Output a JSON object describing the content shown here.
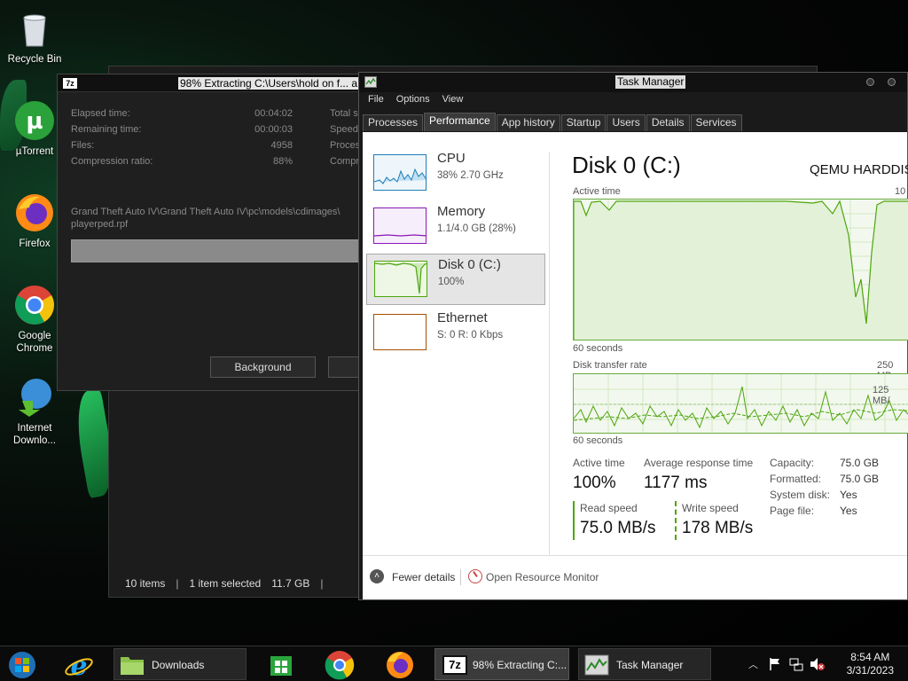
{
  "desktop": {
    "icons": [
      {
        "label": "Recycle Bin",
        "icon": "recycle-bin-icon"
      },
      {
        "label": "µTorrent",
        "icon": "utorrent-icon"
      },
      {
        "label": "Firefox",
        "icon": "firefox-icon"
      },
      {
        "label": "Google Chrome",
        "icon": "chrome-icon"
      },
      {
        "label": "Internet Downlo...",
        "icon": "idm-icon"
      }
    ]
  },
  "explorer": {
    "status_items": "10 items",
    "status_selected": "1 item selected",
    "status_size": "11.7 GB",
    "sep": "|"
  },
  "sevenzip": {
    "title": "98% Extracting C:\\Users\\hold on f... a",
    "icon_text": "7z",
    "rows": [
      {
        "label": "Elapsed time:",
        "value": "00:04:02",
        "right": "Total s"
      },
      {
        "label": "Remaining time:",
        "value": "00:00:03",
        "right": "Speed:"
      },
      {
        "label": "Files:",
        "value": "4958",
        "right": "Proces"
      },
      {
        "label": "Compression ratio:",
        "value": "88%",
        "right": "Compre"
      }
    ],
    "path_line1": "Grand Theft Auto IV\\Grand Theft Auto IV\\pc\\models\\cdimages\\",
    "path_line2": "playerped.rpf",
    "progress": 0.98,
    "background_button": "Background"
  },
  "taskmanager": {
    "title": "Task Manager",
    "menu": [
      "File",
      "Options",
      "View"
    ],
    "tabs": [
      "Processes",
      "Performance",
      "App history",
      "Startup",
      "Users",
      "Details",
      "Services"
    ],
    "active_tab": "Performance",
    "resources": [
      {
        "name": "CPU",
        "sub": "38%  2.70 GHz",
        "color": "#1e7eb4"
      },
      {
        "name": "Memory",
        "sub": "1.1/4.0 GB (28%)",
        "color": "#8b18b5"
      },
      {
        "name": "Disk 0 (C:)",
        "sub": "100%",
        "color": "#4da60c"
      },
      {
        "name": "Ethernet",
        "sub": "S: 0  R: 0 Kbps",
        "color": "#a74f01"
      }
    ],
    "heading": "Disk 0 (C:)",
    "model": "QEMU HARDDIS",
    "graph1_label": "Active time",
    "graph1_max": "10",
    "graph1_time": "60 seconds",
    "graph2_label": "Disk transfer rate",
    "graph2_max": "250 MB",
    "graph2_mid": "125 MB/",
    "graph2_time": "60 seconds",
    "stats": {
      "active_time_label": "Active time",
      "active_time": "100%",
      "resp_label": "Average response time",
      "resp": "1177 ms",
      "read_label": "Read speed",
      "read": "75.0 MB/s",
      "write_label": "Write speed",
      "write": "178 MB/s"
    },
    "props": [
      {
        "k": "Capacity:",
        "v": "75.0 GB"
      },
      {
        "k": "Formatted:",
        "v": "75.0 GB"
      },
      {
        "k": "System disk:",
        "v": "Yes"
      },
      {
        "k": "Page file:",
        "v": "Yes"
      }
    ],
    "fewer_details": "Fewer details",
    "open_monitor": "Open Resource Monitor"
  },
  "taskbar": {
    "downloads": "Downloads",
    "sevenzip": "98% Extracting C:...",
    "taskmanager": "Task Manager",
    "time": "8:54 AM",
    "date": "3/31/2023"
  }
}
